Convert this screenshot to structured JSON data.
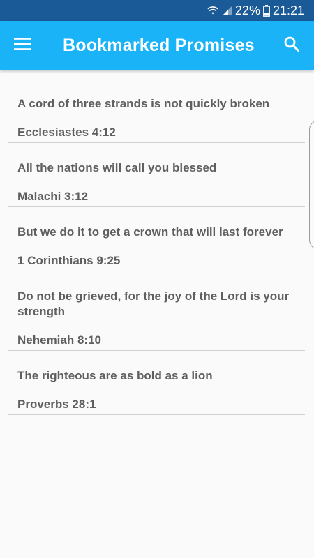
{
  "status_bar": {
    "battery": "22%",
    "time": "21:21"
  },
  "app_bar": {
    "title": "Bookmarked Promises",
    "menu_icon": "hamburger-menu-icon",
    "search_icon": "search-icon"
  },
  "promises": [
    {
      "text": "A cord of three strands is not quickly broken",
      "reference": "Ecclesiastes 4:12"
    },
    {
      "text": "All the nations will call you blessed",
      "reference": "Malachi 3:12"
    },
    {
      "text": "But we do it to get a crown that will last forever",
      "reference": "1 Corinthians 9:25"
    },
    {
      "text": "Do not be grieved, for the joy of the Lord is your strength",
      "reference": "Nehemiah 8:10"
    },
    {
      "text": "The righteous are as bold as a lion",
      "reference": "Proverbs 28:1"
    }
  ],
  "colors": {
    "status_bar": "#1a5a96",
    "app_bar": "#1ab3f7",
    "text": "#5f5f5f",
    "divider": "#cfcfcf",
    "background": "#fafafa"
  }
}
